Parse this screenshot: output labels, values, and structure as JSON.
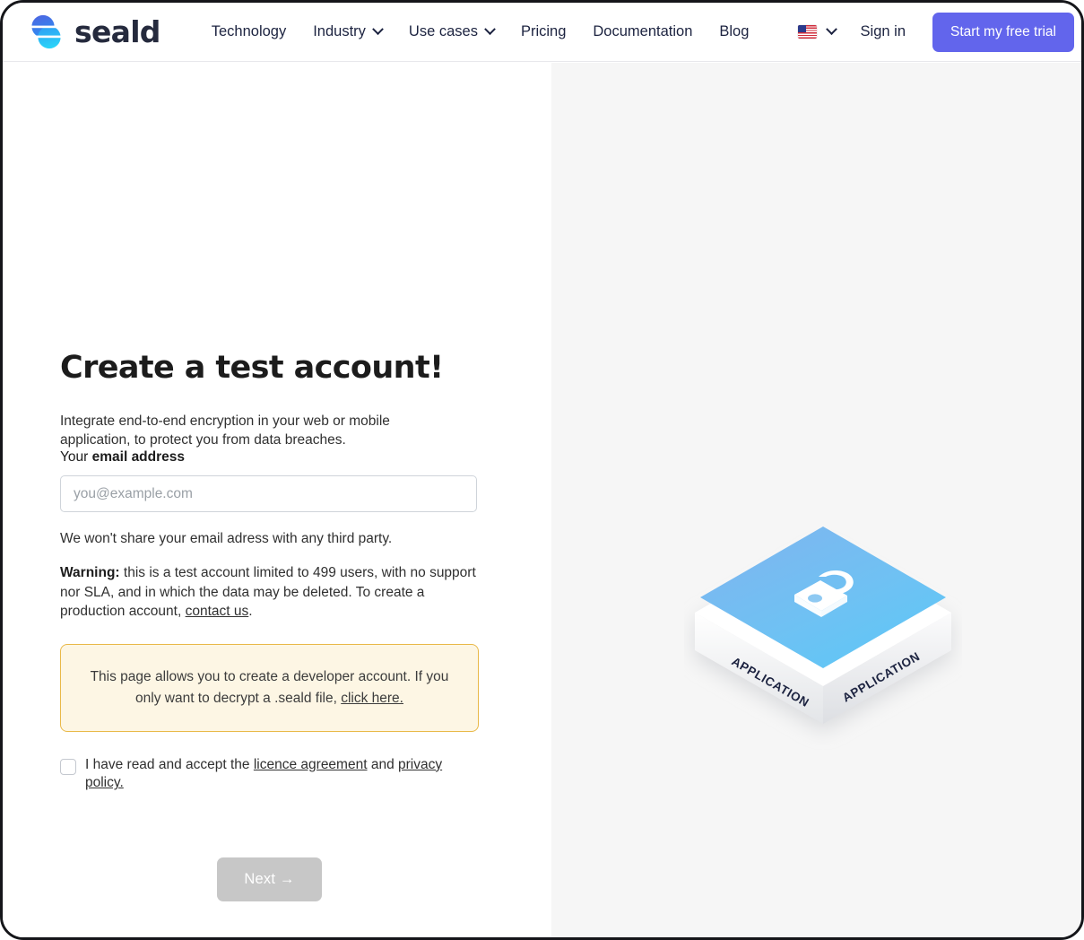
{
  "header": {
    "brand_name": "seald",
    "logo_icon": "seald-logo-icon",
    "nav": [
      {
        "label": "Technology",
        "has_dropdown": false
      },
      {
        "label": "Industry",
        "has_dropdown": true
      },
      {
        "label": "Use cases",
        "has_dropdown": true
      },
      {
        "label": "Pricing",
        "has_dropdown": false
      },
      {
        "label": "Documentation",
        "has_dropdown": false
      },
      {
        "label": "Blog",
        "has_dropdown": false
      }
    ],
    "language": {
      "flag_icon": "us-flag-icon",
      "chevron_icon": "chevron-down-icon"
    },
    "sign_in_label": "Sign in",
    "trial_button_label": "Start my free trial",
    "accent_color": "#6265ec"
  },
  "main": {
    "title": "Create a test account!",
    "subtitle": "Integrate end-to-end encryption in your web or mobile application, to protect you from data breaches.",
    "email": {
      "label_prefix": "Your ",
      "label_strong": "email address",
      "placeholder": "you@example.com",
      "value": "",
      "helper": "We won't share your email adress with any third party."
    },
    "warning": {
      "label": "Warning:",
      "text_before_link": " this is a test account limited to 499 users, with no support nor SLA, and in which the data may be deleted. To create a production account, ",
      "link": "contact us",
      "text_after_link": "."
    },
    "alert": {
      "text_before_link": "This page allows you to create a developer account. If you only want to decrypt a .seald file, ",
      "link": "click here.",
      "background_color": "#fdf6e4",
      "border_color": "#e9b949"
    },
    "terms": {
      "checked": false,
      "text_start": "I have read and accept the ",
      "link_1": "licence agreement",
      "text_middle": " and ",
      "link_2": "privacy policy.",
      "text_end": ""
    },
    "next_button_label": "Next →",
    "next_button_disabled": true
  },
  "illustration": {
    "name": "isometric-application-box",
    "side_label_left": "APPLICATION",
    "side_label_right": "APPLICATION",
    "lock_icon": "padlock-icon",
    "top_color_start": "#7cb9f0",
    "top_color_end": "#63c6f5",
    "background_color": "#f6f6f6"
  }
}
